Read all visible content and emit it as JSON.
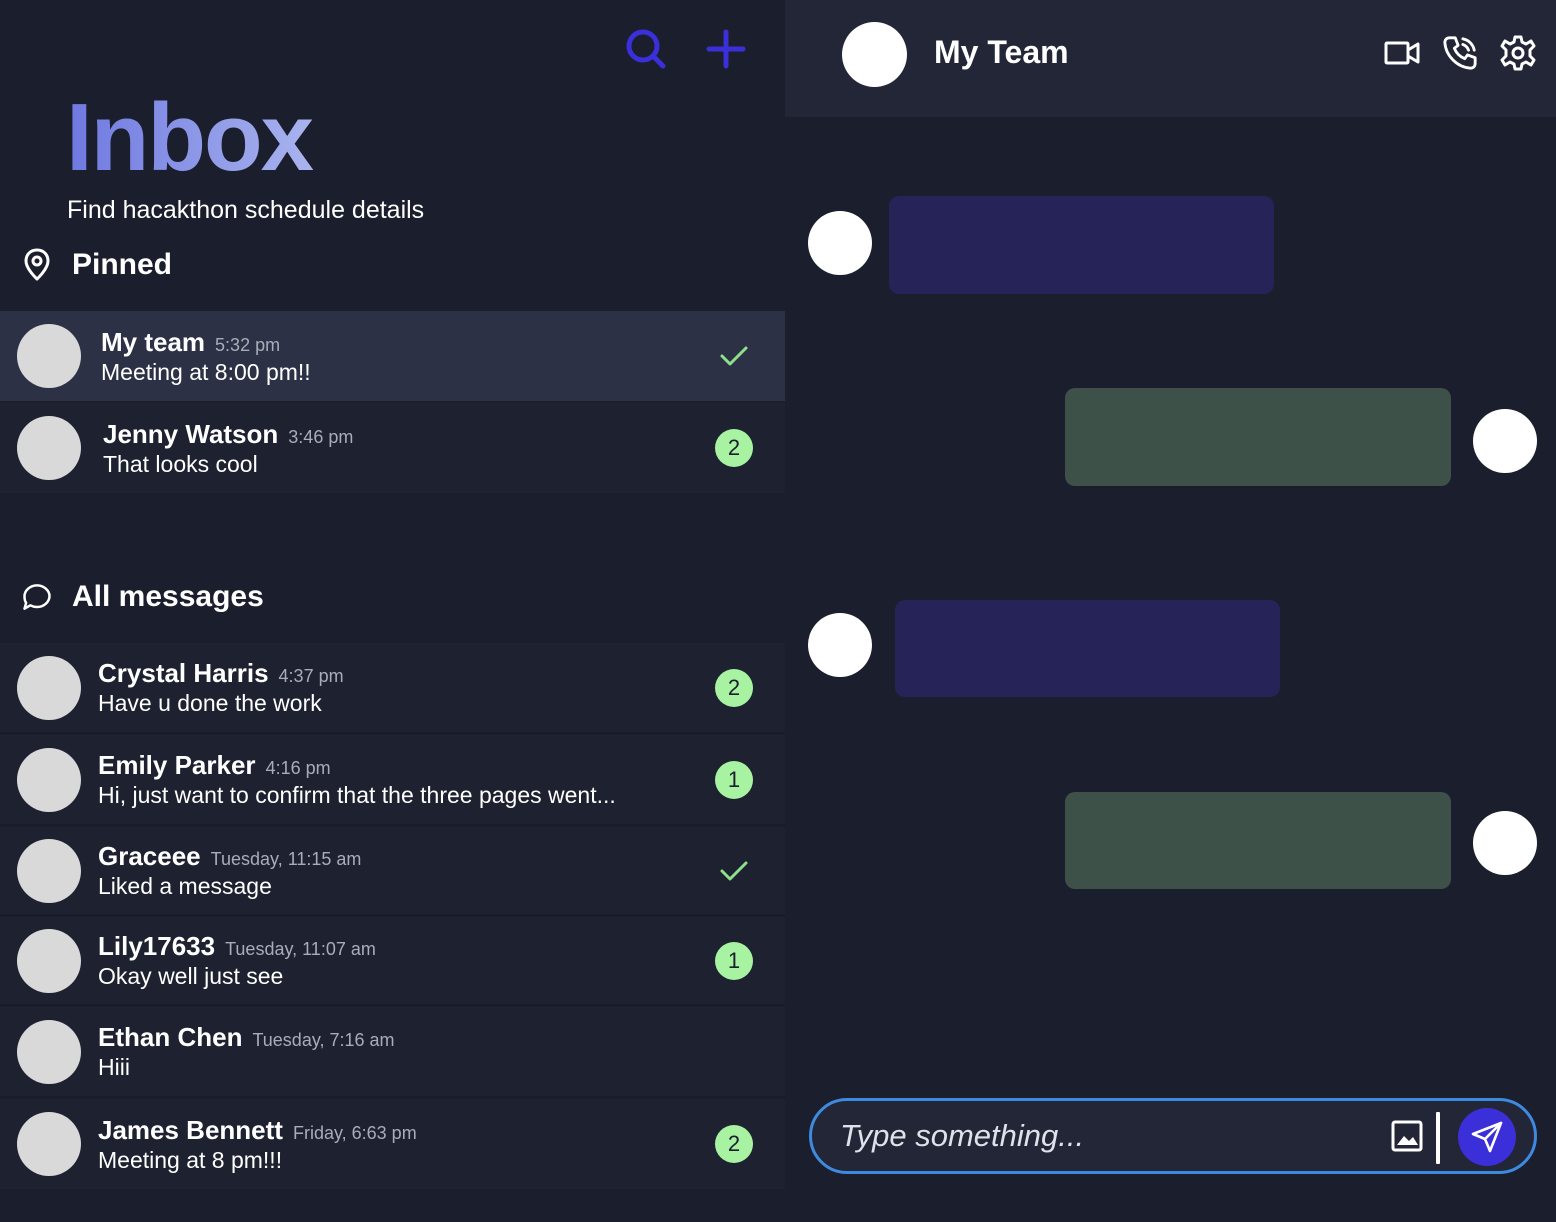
{
  "colors": {
    "accent_purple": "#3a2fd8",
    "inbox_gradient_start": "#6e78e0",
    "inbox_gradient_end": "#a9b4ee",
    "badge_green": "#a7f3a2",
    "check_green": "#8fe08a",
    "bubble_incoming": "#252358",
    "bubble_outgoing": "#3e5149",
    "composer_border": "#3d8ae0"
  },
  "inbox": {
    "title": "Inbox",
    "subtitle": "Find hacakthon schedule details",
    "actions": [
      "search-icon",
      "plus-icon"
    ]
  },
  "pinned": {
    "label": "Pinned",
    "icon": "map-pin-icon",
    "items": [
      {
        "name": "My team",
        "time": "5:32 pm",
        "message": "Meeting at 8:00 pm!!",
        "status": "check",
        "active": true
      },
      {
        "name": "Jenny Watson",
        "time": "3:46 pm",
        "message": "That looks cool",
        "status": "badge",
        "count": "2"
      }
    ]
  },
  "all_messages": {
    "label": "All messages",
    "icon": "chat-bubble-icon",
    "items": [
      {
        "name": "Crystal Harris",
        "time": "4:37 pm",
        "message": "Have u done the work",
        "status": "badge",
        "count": "2"
      },
      {
        "name": "Emily Parker",
        "time": "4:16 pm",
        "message": "Hi, just want to confirm that the three pages went...",
        "status": "badge",
        "count": "1"
      },
      {
        "name": "Graceee",
        "time": "Tuesday, 11:15 am",
        "message": "Liked a message",
        "status": "check"
      },
      {
        "name": "Lily17633",
        "time": "Tuesday, 11:07 am",
        "message": "Okay well just see",
        "status": "badge",
        "count": "1"
      },
      {
        "name": "Ethan Chen",
        "time": "Tuesday, 7:16 am",
        "message": "Hiii",
        "status": "none"
      },
      {
        "name": "James Bennett",
        "time": "Friday, 6:63 pm",
        "message": "Meeting at 8 pm!!!",
        "status": "badge",
        "count": "2"
      }
    ]
  },
  "chat": {
    "title": "My Team",
    "actions": [
      "video-camera-icon",
      "phone-call-icon",
      "gear-icon"
    ],
    "messages": [
      {
        "direction": "incoming"
      },
      {
        "direction": "outgoing"
      },
      {
        "direction": "incoming"
      },
      {
        "direction": "outgoing"
      }
    ],
    "composer": {
      "placeholder": "Type something...",
      "image_icon": "image-icon",
      "send_icon": "send-icon"
    }
  }
}
